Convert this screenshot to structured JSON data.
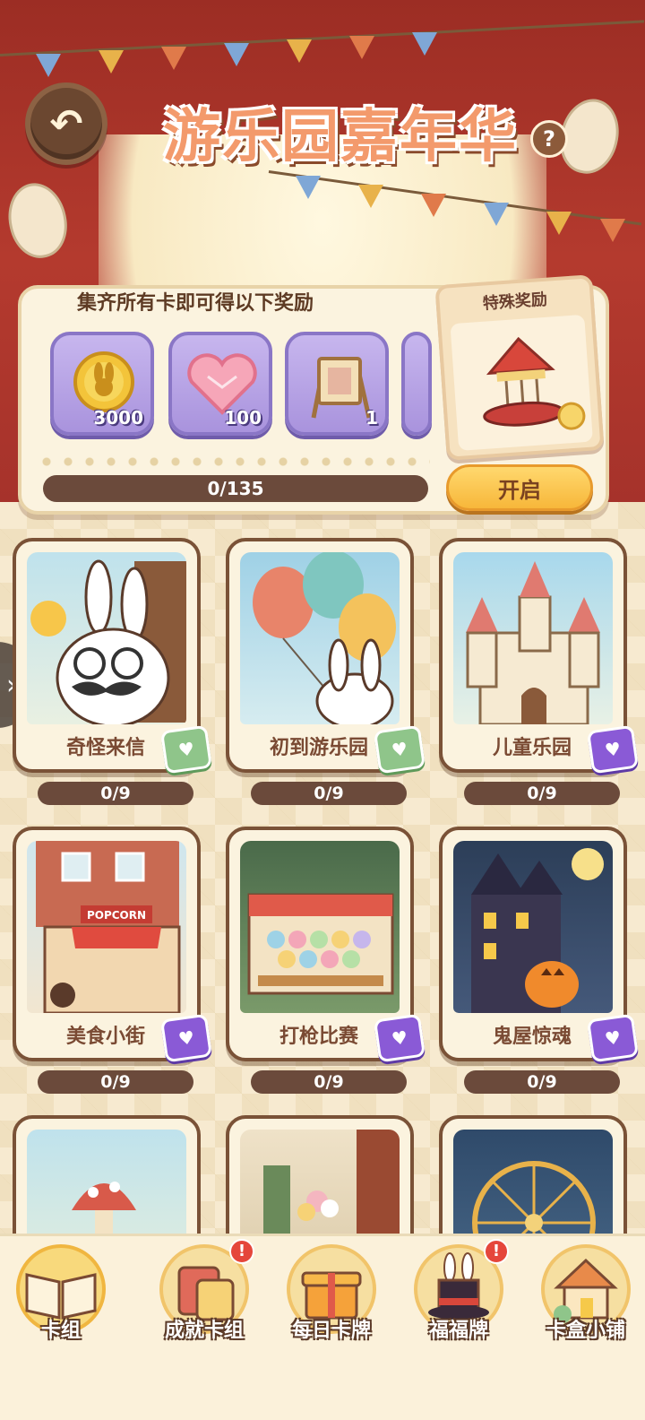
{
  "header": {
    "title": "游乐园嘉年华",
    "help_label": "?"
  },
  "rewards_panel": {
    "title": "集齐所有卡即可得以下奖励",
    "items": [
      {
        "icon": "rabbit-coin-icon",
        "count": "3000"
      },
      {
        "icon": "heart-gem-icon",
        "count": "100"
      },
      {
        "icon": "easel-frame-icon",
        "count": "1"
      }
    ],
    "progress_text": "0/135",
    "special_title": "特殊奖励",
    "open_label": "开启"
  },
  "albums": [
    {
      "name": "奇怪来信",
      "progress": "0/9",
      "box": "green"
    },
    {
      "name": "初到游乐园",
      "progress": "0/9",
      "box": "green"
    },
    {
      "name": "儿童乐园",
      "progress": "0/9",
      "box": "purple"
    },
    {
      "name": "美食小街",
      "progress": "0/9",
      "box": "purple"
    },
    {
      "name": "打枪比赛",
      "progress": "0/9",
      "box": "purple"
    },
    {
      "name": "鬼屋惊魂",
      "progress": "0/9",
      "box": "purple"
    }
  ],
  "bottom_nav": [
    {
      "label": "卡组",
      "icon": "open-book-icon",
      "badge": "",
      "active": true
    },
    {
      "label": "成就卡组",
      "icon": "card-stack-icon",
      "badge": "!",
      "active": false
    },
    {
      "label": "每日卡牌",
      "icon": "gift-box-icon",
      "badge": "",
      "active": false
    },
    {
      "label": "福福牌",
      "icon": "magic-hat-icon",
      "badge": "!",
      "active": false
    },
    {
      "label": "卡盒小铺",
      "icon": "shop-house-icon",
      "badge": "",
      "active": false
    }
  ],
  "colors": {
    "curtain": "#b43a2e",
    "progress_bar": "#6b4a3b",
    "open_button": "#f7b73a",
    "reward_tile": "#a993dd"
  }
}
